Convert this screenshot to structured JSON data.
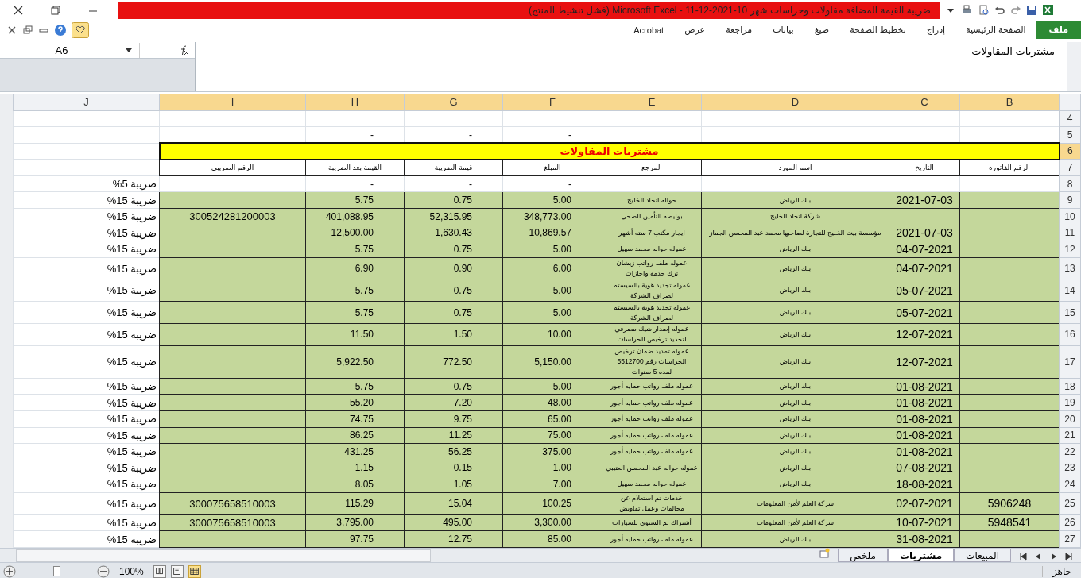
{
  "window": {
    "title": "ضريبة القيمة المضافة  مقاولات وحراسات شهر 10-2021-12-11 - Microsoft Excel (فشل تنشيط المنتج)"
  },
  "ribbon_tabs": [
    {
      "label": "ملف",
      "selected": true
    },
    {
      "label": "الصفحة الرئيسية",
      "selected": false
    },
    {
      "label": "إدراج",
      "selected": false
    },
    {
      "label": "تخطيط الصفحة",
      "selected": false
    },
    {
      "label": "صيغ",
      "selected": false
    },
    {
      "label": "بيانات",
      "selected": false
    },
    {
      "label": "مراجعة",
      "selected": false
    },
    {
      "label": "عرض",
      "selected": false
    },
    {
      "label": "Acrobat",
      "selected": false
    }
  ],
  "formula_bar": {
    "name_box": "A6",
    "formula": "مشتريات المقاولات"
  },
  "columns": [
    {
      "label": "B",
      "selected": true
    },
    {
      "label": "C",
      "selected": true
    },
    {
      "label": "D",
      "selected": true
    },
    {
      "label": "E",
      "selected": true
    },
    {
      "label": "F",
      "selected": true
    },
    {
      "label": "G",
      "selected": true
    },
    {
      "label": "H",
      "selected": true
    },
    {
      "label": "I",
      "selected": true
    },
    {
      "label": "J",
      "selected": false
    }
  ],
  "rows": [
    {
      "number": "4",
      "selected": false,
      "kind": "plain"
    },
    {
      "number": "5",
      "selected": false,
      "kind": "plain",
      "amount": "-",
      "tax": "-",
      "total": "-"
    },
    {
      "number": "6",
      "selected": true,
      "kind": "title",
      "title": "مشتريات المقاولات"
    },
    {
      "number": "7",
      "selected": false,
      "kind": "header",
      "invoice_no": "الرقم الفاتوره",
      "date": "التاريخ",
      "supplier": "اسم المورد",
      "reference": "المرجع",
      "amount": "المبلغ",
      "tax": "قيمة الضريبة",
      "total": "القيمة بعد الضريبة",
      "tax_number": "الرقم الضريبي"
    },
    {
      "number": "8",
      "selected": false,
      "kind": "plain",
      "amount": "-",
      "tax": "-",
      "total": "-",
      "tax_rate": "ضريبة 5%"
    },
    {
      "number": "9",
      "selected": false,
      "kind": "entry",
      "date": "2021-07-03",
      "supplier": "بنك الرياض",
      "reference": "حواله اتحاد الخليج",
      "amount": "5.00",
      "tax": "0.75",
      "total": "5.75",
      "tax_rate": "ضريبة 15%"
    },
    {
      "number": "10",
      "selected": false,
      "kind": "entry",
      "supplier": "شركة اتحاد الخليج",
      "reference": "بوليصه التأمين الصحي",
      "amount": "348,773.00",
      "tax": "52,315.95",
      "total": "401,088.95",
      "tax_number": "300524281200003",
      "tax_rate": "ضريبة 15%"
    },
    {
      "number": "11",
      "selected": false,
      "kind": "entry",
      "date": "2021-07-03",
      "supplier": "مؤسسة بيت الخليج للتجارة لصاحبها محمد عبد المحسن الجماز",
      "reference": "ايجار مكتب 7 سته أشهر",
      "amount": "10,869.57",
      "tax": "1,630.43",
      "total": "12,500.00",
      "tax_rate": "ضريبة 15%"
    },
    {
      "number": "12",
      "selected": false,
      "kind": "entry",
      "date": "04-07-2021",
      "supplier": "بنك الرياض",
      "reference": "عموله حواله محمد سهيل",
      "amount": "5.00",
      "tax": "0.75",
      "total": "5.75",
      "tax_rate": "ضريبة 15%"
    },
    {
      "number": "13",
      "selected": false,
      "kind": "entry",
      "date": "04-07-2021",
      "supplier": "بنك الرياض",
      "reference": "عموله ملف رواتب زيشان\nترك خدمة واجازات",
      "amount": "6.00",
      "tax": "0.90",
      "total": "6.90",
      "tax_rate": "ضريبة 15%"
    },
    {
      "number": "14",
      "selected": false,
      "kind": "entry",
      "date": "05-07-2021",
      "supplier": "بنك الرياض",
      "reference": "عموله تجديد هوية بالسيستم\nلصراف الشركة",
      "amount": "5.00",
      "tax": "0.75",
      "total": "5.75",
      "tax_rate": "ضريبة 15%"
    },
    {
      "number": "15",
      "selected": false,
      "kind": "entry",
      "date": "05-07-2021",
      "supplier": "بنك الرياض",
      "reference": "عموله تجديد هوية بالسيستم\nلصراف الشركة",
      "amount": "5.00",
      "tax": "0.75",
      "total": "5.75",
      "tax_rate": "ضريبة 15%"
    },
    {
      "number": "16",
      "selected": false,
      "kind": "entry",
      "date": "12-07-2021",
      "supplier": "بنك الرياض",
      "reference": "عموله إصدار شيك مصرفي\nلتجديد ترخيص الحراسات",
      "amount": "10.00",
      "tax": "1.50",
      "total": "11.50",
      "tax_rate": "ضريبة 15%"
    },
    {
      "number": "17",
      "selected": false,
      "kind": "entry",
      "date": "12-07-2021",
      "supplier": "بنك الرياض",
      "reference": "عموله تمديد ضمان ترخيص\nالحراسات رقم 5512700\nلمده 5 سنوات",
      "amount": "5,150.00",
      "tax": "772.50",
      "total": "5,922.50",
      "tax_rate": "ضريبة 15%"
    },
    {
      "number": "18",
      "selected": false,
      "kind": "entry",
      "date": "01-08-2021",
      "supplier": "بنك الرياض",
      "reference": "عموله ملف رواتب حمايه أجور",
      "amount": "5.00",
      "tax": "0.75",
      "total": "5.75",
      "tax_rate": "ضريبة 15%"
    },
    {
      "number": "19",
      "selected": false,
      "kind": "entry",
      "date": "01-08-2021",
      "supplier": "بنك الرياض",
      "reference": "عموله ملف رواتب حمايه أجور",
      "amount": "48.00",
      "tax": "7.20",
      "total": "55.20",
      "tax_rate": "ضريبة 15%"
    },
    {
      "number": "20",
      "selected": false,
      "kind": "entry",
      "date": "01-08-2021",
      "supplier": "بنك الرياض",
      "reference": "عموله ملف رواتب حمايه أجور",
      "amount": "65.00",
      "tax": "9.75",
      "total": "74.75",
      "tax_rate": "ضريبة 15%"
    },
    {
      "number": "21",
      "selected": false,
      "kind": "entry",
      "date": "01-08-2021",
      "supplier": "بنك الرياض",
      "reference": "عموله ملف رواتب حمايه أجور",
      "amount": "75.00",
      "tax": "11.25",
      "total": "86.25",
      "tax_rate": "ضريبة 15%"
    },
    {
      "number": "22",
      "selected": false,
      "kind": "entry",
      "date": "01-08-2021",
      "supplier": "بنك الرياض",
      "reference": "عموله ملف رواتب حمايه أجور",
      "amount": "375.00",
      "tax": "56.25",
      "total": "431.25",
      "tax_rate": "ضريبة 15%"
    },
    {
      "number": "23",
      "selected": false,
      "kind": "entry",
      "date": "07-08-2021",
      "supplier": "بنك الرياض",
      "reference": "عموله حواله عبد المحسن العتيبي",
      "amount": "1.00",
      "tax": "0.15",
      "total": "1.15",
      "tax_rate": "ضريبة 15%"
    },
    {
      "number": "24",
      "selected": false,
      "kind": "entry",
      "date": "18-08-2021",
      "supplier": "بنك الرياض",
      "reference": "عموله حواله محمد سهيل",
      "amount": "7.00",
      "tax": "1.05",
      "total": "8.05",
      "tax_rate": "ضريبة 15%"
    },
    {
      "number": "25",
      "selected": false,
      "kind": "entry",
      "invoice_no": "5906248",
      "date": "02-07-2021",
      "supplier": "شركة العلم لأمن المعلومات",
      "reference": "خدمات تم استعلام عن\nمخالفات وعمل تفاويض",
      "amount": "100.25",
      "tax": "15.04",
      "total": "115.29",
      "tax_number": "300075658510003",
      "tax_rate": "ضريبة 15%"
    },
    {
      "number": "26",
      "selected": false,
      "kind": "entry",
      "invoice_no": "5948541",
      "date": "10-07-2021",
      "supplier": "شركة العلم لأمن المعلومات",
      "reference": "أشتراك تم السنوي للسيارات",
      "amount": "3,300.00",
      "tax": "495.00",
      "total": "3,795.00",
      "tax_number": "300075658510003",
      "tax_rate": "ضريبة 15%"
    },
    {
      "number": "27",
      "selected": false,
      "kind": "entry",
      "date": "31-08-2021",
      "supplier": "بنك الرياض",
      "reference": "عموله ملف رواتب حمايه أجور",
      "amount": "85.00",
      "tax": "12.75",
      "total": "97.75",
      "tax_rate": "ضريبة 15%"
    }
  ],
  "sheet_tabs": [
    {
      "label": "المبيعات",
      "selected": false
    },
    {
      "label": "مشتريات",
      "selected": true
    },
    {
      "label": "ملخص",
      "selected": false
    }
  ],
  "status_bar": {
    "status": "جاهز",
    "zoom": "100%",
    "level": 0.5,
    "view_buttons": [
      {
        "kind": "page-break",
        "selected": false
      },
      {
        "kind": "page-layout",
        "selected": false
      },
      {
        "kind": "normal",
        "selected": true
      }
    ]
  }
}
